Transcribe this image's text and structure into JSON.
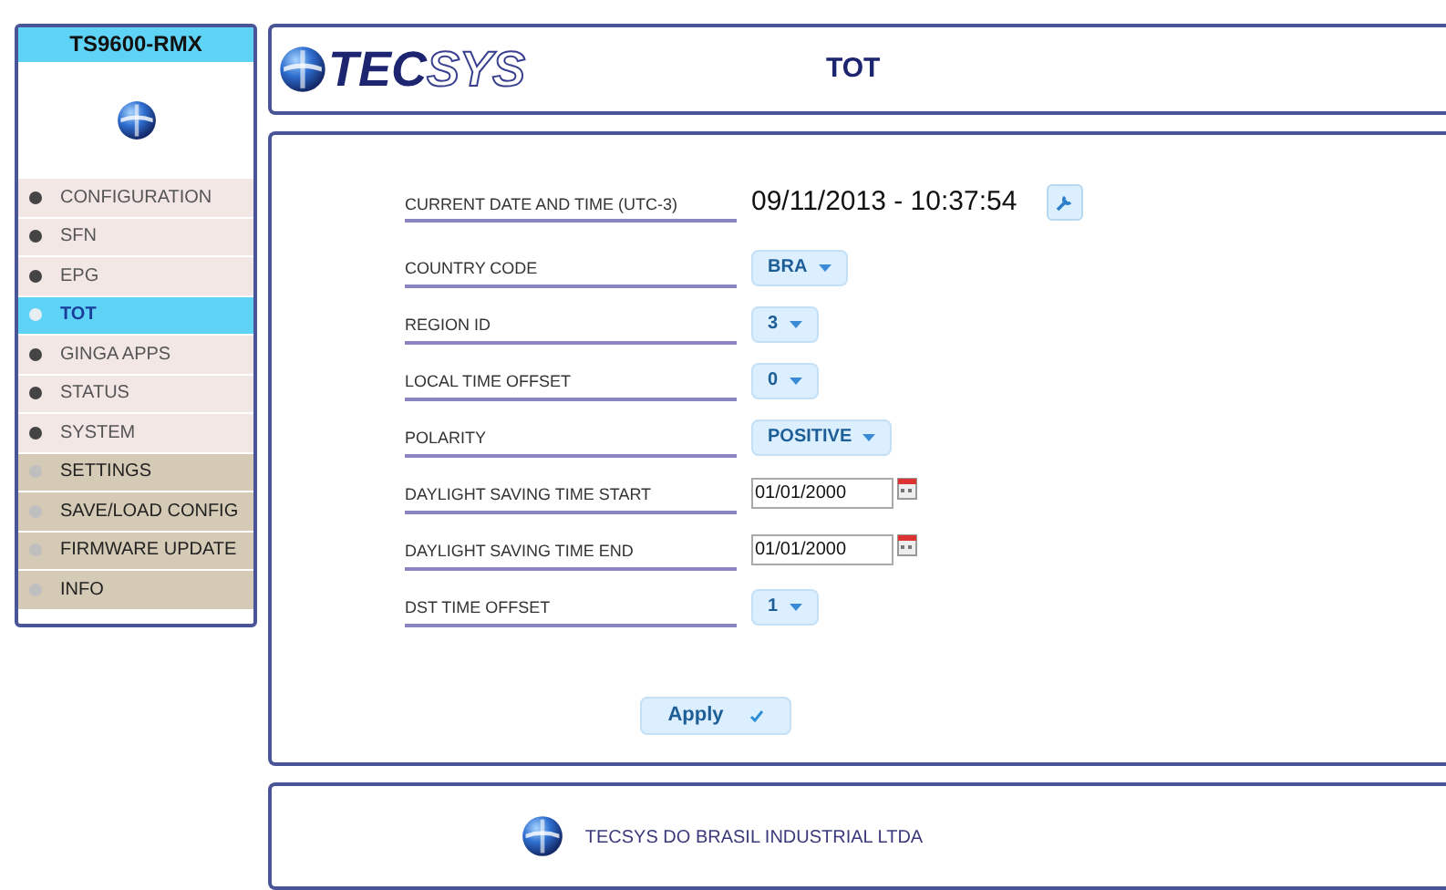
{
  "sidebar": {
    "device": "TS9600-RMX",
    "items": [
      {
        "label": "CONFIGURATION",
        "kind": "main",
        "selected": false
      },
      {
        "label": "SFN",
        "kind": "main",
        "selected": false
      },
      {
        "label": "EPG",
        "kind": "main",
        "selected": false
      },
      {
        "label": "TOT",
        "kind": "main",
        "selected": true
      },
      {
        "label": "GINGA APPS",
        "kind": "main",
        "selected": false
      },
      {
        "label": "STATUS",
        "kind": "main",
        "selected": false
      },
      {
        "label": "SYSTEM",
        "kind": "main",
        "selected": false
      },
      {
        "label": "SETTINGS",
        "kind": "section",
        "selected": false
      },
      {
        "label": "SAVE/LOAD CONFIG",
        "kind": "section",
        "selected": false
      },
      {
        "label": "FIRMWARE UPDATE",
        "kind": "section",
        "selected": false
      },
      {
        "label": "INFO",
        "kind": "section",
        "selected": false
      }
    ]
  },
  "header": {
    "logo_bold": "TEC",
    "logo_outline": "SYS",
    "title": "TOT"
  },
  "form": {
    "fields": [
      {
        "label": "CURRENT DATE AND TIME (UTC-3)",
        "kind": "datetime",
        "value": "09/11/2013 - 10:37:54"
      },
      {
        "label": "COUNTRY CODE",
        "kind": "select",
        "value": "BRA"
      },
      {
        "label": "REGION ID",
        "kind": "select",
        "value": "3"
      },
      {
        "label": "LOCAL TIME OFFSET",
        "kind": "select",
        "value": "0"
      },
      {
        "label": "POLARITY",
        "kind": "select",
        "value": "POSITIVE"
      },
      {
        "label": "DAYLIGHT SAVING TIME START",
        "kind": "date",
        "value": "01/01/2000"
      },
      {
        "label": "DAYLIGHT SAVING TIME END",
        "kind": "date",
        "value": "01/01/2000"
      },
      {
        "label": "DST TIME OFFSET",
        "kind": "select",
        "value": "1"
      }
    ],
    "apply": "Apply"
  },
  "footer": {
    "company": "TECSYS DO BRASIL INDUSTRIAL LTDA"
  }
}
